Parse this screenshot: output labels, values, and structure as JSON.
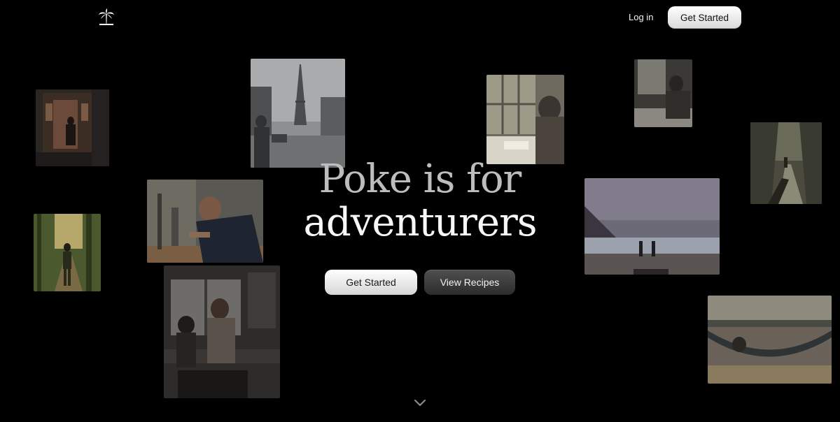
{
  "header": {
    "logo_icon": "palm-tree-icon",
    "login_label": "Log in",
    "get_started_label": "Get Started"
  },
  "hero": {
    "line1": "Poke is for",
    "line2": "adventurers"
  },
  "cta": {
    "primary_label": "Get Started",
    "secondary_label": "View Recipes"
  },
  "scroll_icon": "chevron-down-icon",
  "photos": [
    {
      "subject": "person-in-doorway"
    },
    {
      "subject": "eiffel-tower-rainy-street"
    },
    {
      "subject": "person-reading-by-window"
    },
    {
      "subject": "person-at-window"
    },
    {
      "subject": "person-walking-road"
    },
    {
      "subject": "person-working-at-desk"
    },
    {
      "subject": "forest-trail-hiker"
    },
    {
      "subject": "people-on-beach"
    },
    {
      "subject": "parent-and-child-in-kitchen"
    },
    {
      "subject": "person-in-hammock"
    }
  ],
  "colors": {
    "background": "#000000",
    "text_primary": "#f7f7f7",
    "text_muted": "#bdbdbd",
    "button_light": "#e8e8e8",
    "button_dark": "#3a3a3a"
  }
}
